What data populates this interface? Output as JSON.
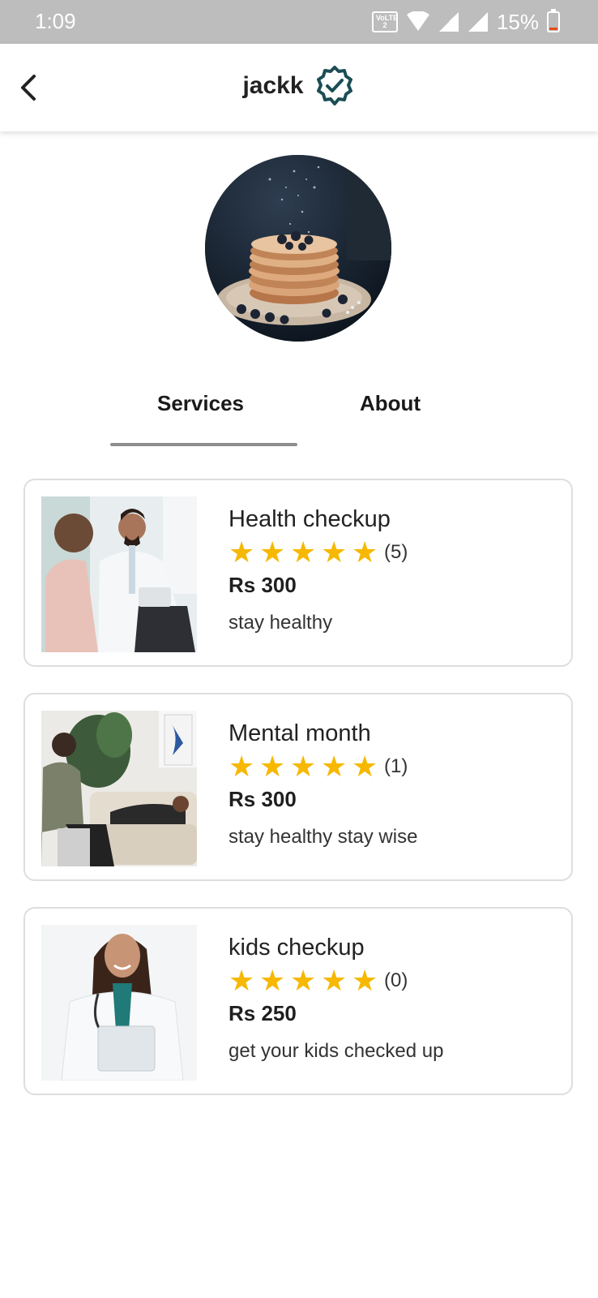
{
  "status_bar": {
    "time": "1:09",
    "volte": "VoLTE 2",
    "battery": "15%"
  },
  "app_bar": {
    "title": "jackk",
    "verified_color": "#1b4d55"
  },
  "tabs": [
    {
      "label": "Services",
      "selected": true
    },
    {
      "label": "About",
      "selected": false
    }
  ],
  "services": [
    {
      "title": "Health checkup",
      "rating_count": "(5)",
      "price": "Rs 300",
      "description": "stay healthy",
      "stars": 5
    },
    {
      "title": "Mental month",
      "rating_count": "(1)",
      "price": "Rs 300",
      "description": "stay healthy stay wise",
      "stars": 5
    },
    {
      "title": "kids checkup",
      "rating_count": "(0)",
      "price": "Rs 250",
      "description": "get your kids checked up",
      "stars": 5
    }
  ],
  "colors": {
    "star": "#f6b800",
    "status_bar_bg": "#bdbdbd",
    "tab_indicator": "#8e8e8e"
  }
}
